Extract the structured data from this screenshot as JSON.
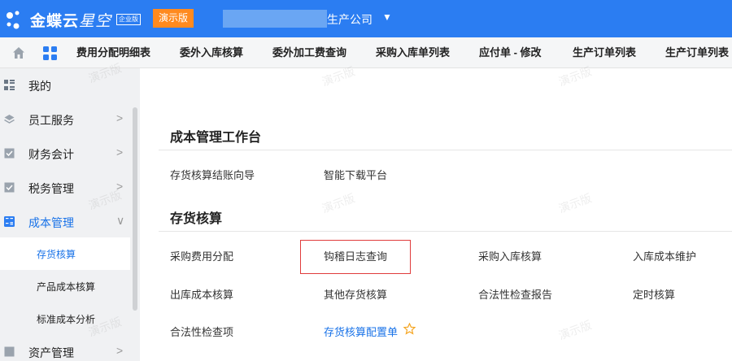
{
  "header": {
    "brand": "金蝶云",
    "brand_sub": "星空",
    "edition": "企业版",
    "demo_label": "演示版",
    "company_name": "生产公司",
    "company_caret": "▼",
    "colors": {
      "header_bg": "#2b7df2",
      "demo_bg": "#ff8a1f"
    }
  },
  "tabs": [
    {
      "label": "费用分配明细表"
    },
    {
      "label": "委外入库核算"
    },
    {
      "label": "委外加工费查询"
    },
    {
      "label": "采购入库单列表"
    },
    {
      "label": "应付单 - 修改"
    },
    {
      "label": "生产订单列表"
    },
    {
      "label": "生产订单列表"
    }
  ],
  "sidebar": {
    "items": [
      {
        "label": "我的",
        "icon": "grid-list-icon"
      },
      {
        "label": "员工服务",
        "icon": "layers-icon",
        "chevron": ">"
      },
      {
        "label": "财务会计",
        "icon": "checkbox-icon",
        "chevron": ">"
      },
      {
        "label": "税务管理",
        "icon": "checkbox-icon",
        "chevron": ">"
      },
      {
        "label": "成本管理",
        "icon": "calculator-icon",
        "chevron": "∨"
      }
    ],
    "sub_items": [
      {
        "label": "存货核算"
      },
      {
        "label": "产品成本核算"
      },
      {
        "label": "标准成本分析"
      }
    ],
    "last_item": {
      "label": "资产管理",
      "chevron": ">"
    }
  },
  "main": {
    "section1": {
      "title": "成本管理工作台",
      "links": [
        "存货核算结账向导",
        "智能下载平台"
      ]
    },
    "section2": {
      "title": "存货核算",
      "row1": [
        "采购费用分配",
        "钩稽日志查询",
        "采购入库核算",
        "入库成本维护"
      ],
      "row2": [
        "出库成本核算",
        "其他存货核算",
        "合法性检查报告",
        "定时核算"
      ],
      "row3": [
        "合法性检查项",
        "存货核算配置单"
      ]
    },
    "watermark": "演示版"
  }
}
